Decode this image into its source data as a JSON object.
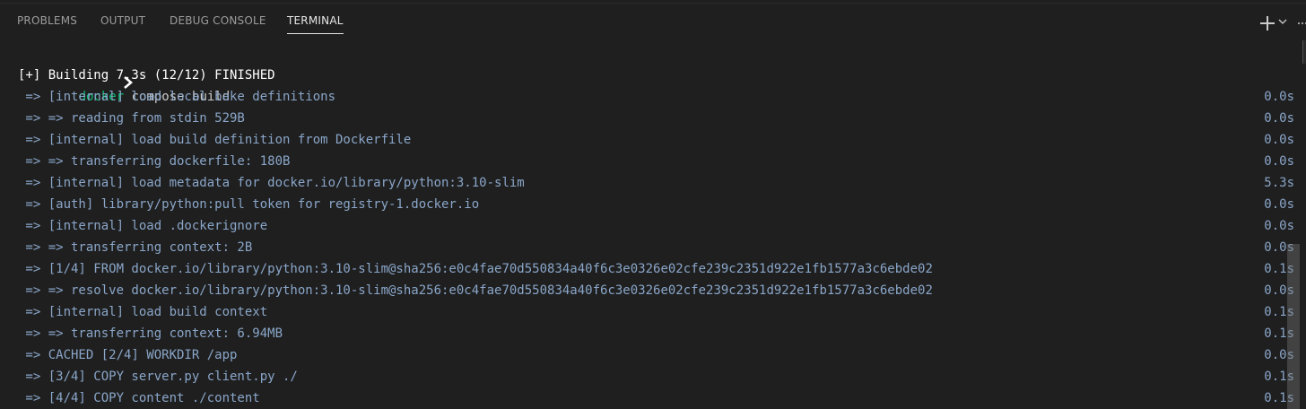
{
  "tabs": {
    "problems": "PROBLEMS",
    "output": "OUTPUT",
    "debug_console": "DEBUG CONSOLE",
    "terminal": "TERMINAL"
  },
  "toolbar": {
    "new_terminal_icon": "plus-icon",
    "launch_profile_icon": "chevron-down-icon",
    "more_actions_icon": "ellipsis-icon"
  },
  "terminal": {
    "prompt_command": "docker",
    "prompt_args": " compose build",
    "header": "[+] Building 7.3s (12/12) FINISHED",
    "lines": [
      {
        "text": " => [internal] load local bake definitions",
        "dur": "0.0s"
      },
      {
        "text": " => => reading from stdin 529B",
        "dur": "0.0s"
      },
      {
        "text": " => [internal] load build definition from Dockerfile",
        "dur": "0.0s"
      },
      {
        "text": " => => transferring dockerfile: 180B",
        "dur": "0.0s"
      },
      {
        "text": " => [internal] load metadata for docker.io/library/python:3.10-slim",
        "dur": "5.3s"
      },
      {
        "text": " => [auth] library/python:pull token for registry-1.docker.io",
        "dur": "0.0s"
      },
      {
        "text": " => [internal] load .dockerignore",
        "dur": "0.0s"
      },
      {
        "text": " => => transferring context: 2B",
        "dur": "0.0s"
      },
      {
        "text": " => [1/4] FROM docker.io/library/python:3.10-slim@sha256:e0c4fae70d550834a40f6c3e0326e02cfe239c2351d922e1fb1577a3c6ebde02",
        "dur": "0.1s"
      },
      {
        "text": " => => resolve docker.io/library/python:3.10-slim@sha256:e0c4fae70d550834a40f6c3e0326e02cfe239c2351d922e1fb1577a3c6ebde02",
        "dur": "0.0s"
      },
      {
        "text": " => [internal] load build context",
        "dur": "0.1s"
      },
      {
        "text": " => => transferring context: 6.94MB",
        "dur": "0.1s"
      },
      {
        "text": " => CACHED [2/4] WORKDIR /app",
        "dur": "0.0s"
      },
      {
        "text": " => [3/4] COPY server.py client.py ./",
        "dur": "0.1s"
      },
      {
        "text": " => [4/4] COPY content ./content",
        "dur": "0.1s"
      }
    ]
  },
  "colors": {
    "background": "#1f1f1f",
    "command_green": "#0dbc79",
    "step_blue": "#8aa6c9",
    "tab_active": "#e7e7e7",
    "tab_inactive": "#9d9d9d"
  }
}
